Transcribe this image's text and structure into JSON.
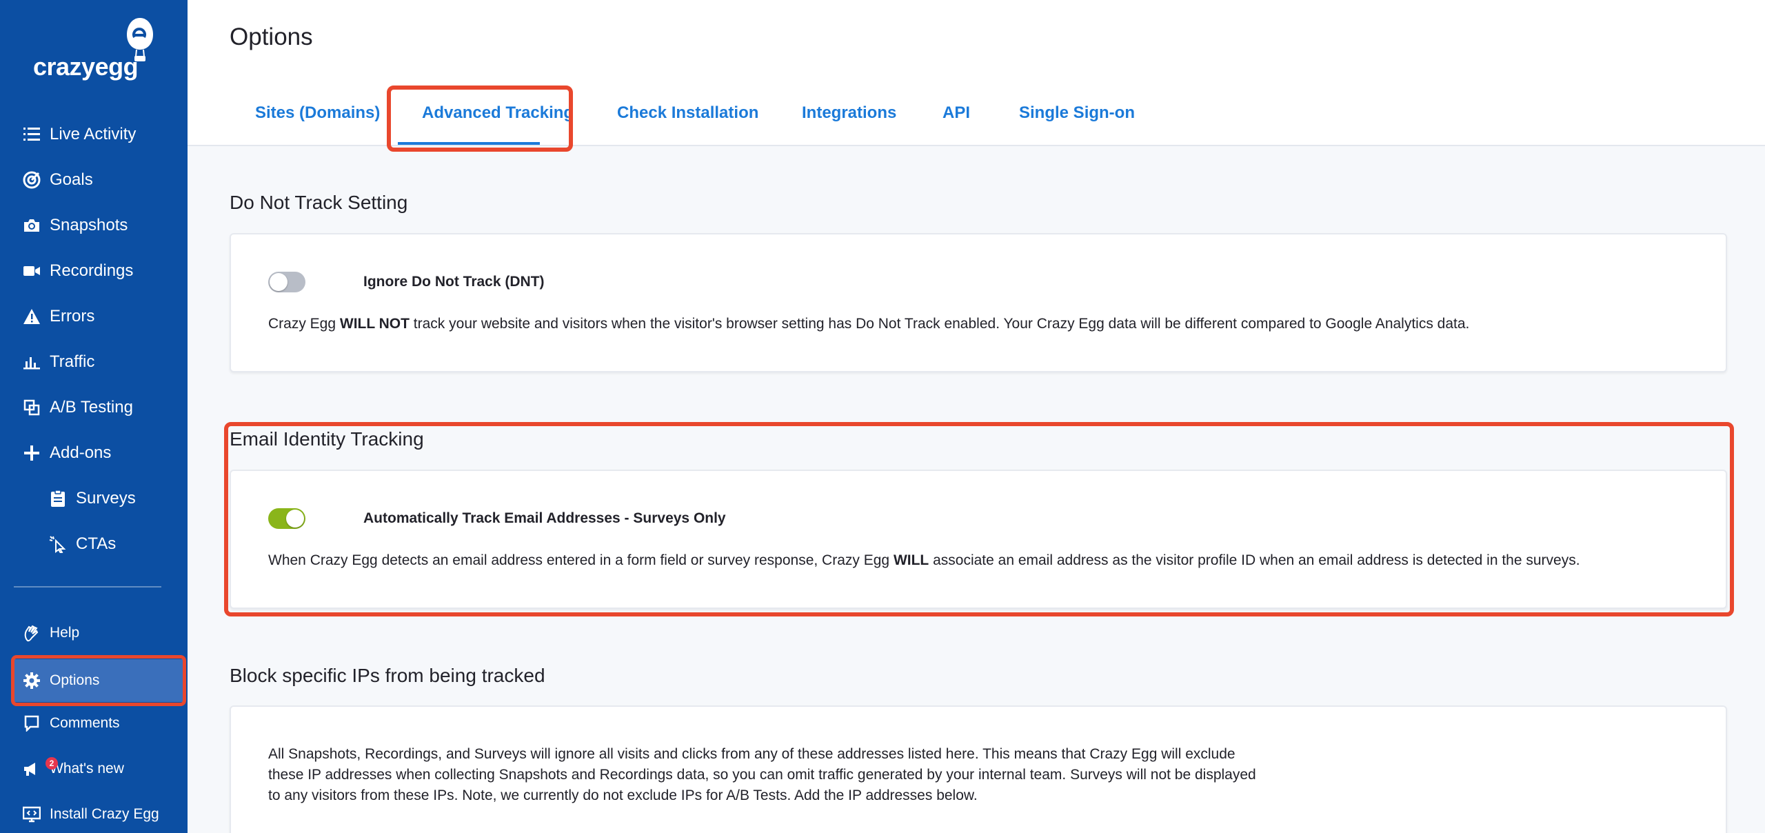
{
  "logo": {
    "text": "crazyegg"
  },
  "sidebar": {
    "items": [
      {
        "label": "Live Activity",
        "icon": "list-icon"
      },
      {
        "label": "Goals",
        "icon": "target-icon"
      },
      {
        "label": "Snapshots",
        "icon": "camera-icon"
      },
      {
        "label": "Recordings",
        "icon": "video-icon"
      },
      {
        "label": "Errors",
        "icon": "warning-icon"
      },
      {
        "label": "Traffic",
        "icon": "bar-chart-icon"
      },
      {
        "label": "A/B Testing",
        "icon": "ab-test-icon"
      },
      {
        "label": "Add-ons",
        "icon": "plus-icon"
      },
      {
        "label": "Surveys",
        "icon": "clipboard-icon"
      },
      {
        "label": "CTAs",
        "icon": "cursor-click-icon"
      }
    ],
    "bottom": [
      {
        "label": "Help",
        "icon": "hand-wave-icon"
      },
      {
        "label": "Options",
        "icon": "gear-icon"
      },
      {
        "label": "Comments",
        "icon": "comment-icon"
      },
      {
        "label": "What's new",
        "icon": "megaphone-icon",
        "badge": "2"
      },
      {
        "label": "Install Crazy Egg",
        "icon": "monitor-code-icon"
      }
    ]
  },
  "page": {
    "title": "Options"
  },
  "tabs": [
    {
      "label": "Sites (Domains)"
    },
    {
      "label": "Advanced Tracking",
      "active": true
    },
    {
      "label": "Check Installation"
    },
    {
      "label": "Integrations"
    },
    {
      "label": "API"
    },
    {
      "label": "Single Sign-on"
    }
  ],
  "dnt": {
    "title": "Do Not Track Setting",
    "toggle_label": "Ignore Do Not Track (DNT)",
    "toggle_on": false,
    "desc_pre": "Crazy Egg ",
    "desc_bold": "WILL NOT",
    "desc_post": " track your website and visitors when the visitor's browser setting has Do Not Track enabled. Your Crazy Egg data will be different compared to Google Analytics data."
  },
  "email": {
    "title": "Email Identity Tracking",
    "toggle_label": "Automatically Track Email Addresses - Surveys Only",
    "toggle_on": true,
    "desc_pre": "When Crazy Egg detects an email address entered in a form field or survey response, Crazy Egg ",
    "desc_bold": "WILL",
    "desc_post": " associate an email address as the visitor profile ID when an email address is detected in the surveys."
  },
  "block_ips": {
    "title": "Block specific IPs from being tracked",
    "desc_line1": "All Snapshots, Recordings, and Surveys will ignore all visits and clicks from any of these addresses listed here. This means that Crazy Egg will exclude",
    "desc_line2": "these IP addresses when collecting Snapshots and Recordings data, so you can omit traffic generated by your internal team. Surveys will not be displayed",
    "desc_line3": "to any visitors from these IPs. Note, we currently do not exclude IPs for A/B Tests. Add the IP addresses below."
  },
  "colors": {
    "sidebar_bg": "#0c4fa3",
    "active_item_bg": "#3a6fbb",
    "accent_link": "#1b7ad9",
    "highlight_frame": "#e9472d",
    "toggle_on": "#8ab51a",
    "toggle_off": "#b8bdc7"
  }
}
